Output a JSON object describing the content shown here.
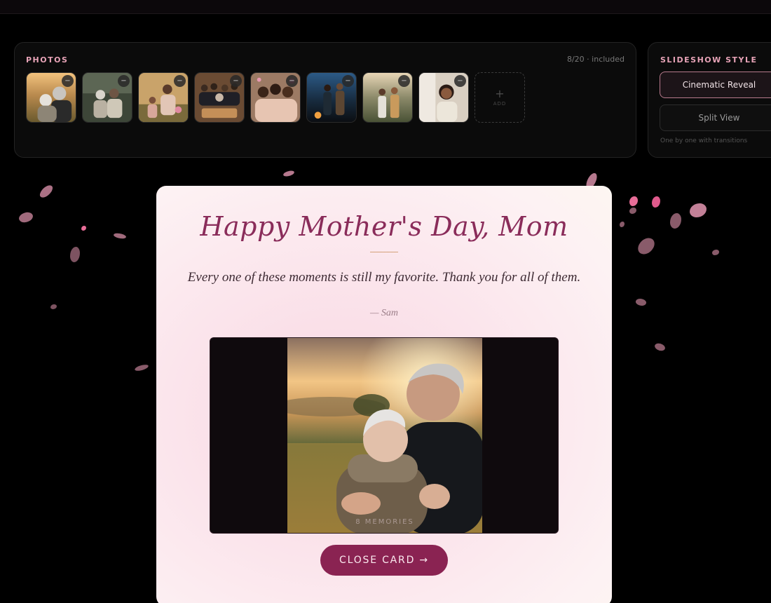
{
  "photos_panel": {
    "title": "PHOTOS",
    "count": "8/20 · included",
    "remove_label": "−",
    "add_label": "ADD",
    "add_plus": "+"
  },
  "style_panel": {
    "title": "SLIDESHOW STYLE",
    "options": [
      "Cinematic Reveal",
      "Split View"
    ],
    "selected": "Cinematic Reveal",
    "hint": "One by one with transitions"
  },
  "card": {
    "title": "Happy Mother's Day, Mom",
    "message": "Every one of these moments is still my favorite. Thank you for all of them.",
    "signature": "— Sam",
    "memories_label": "8 MEMORIES",
    "close_button": "CLOSE CARD →"
  },
  "colors": {
    "accent": "#8a2352",
    "title": "#8a2c5a",
    "panel_label": "#e7a3b7"
  }
}
